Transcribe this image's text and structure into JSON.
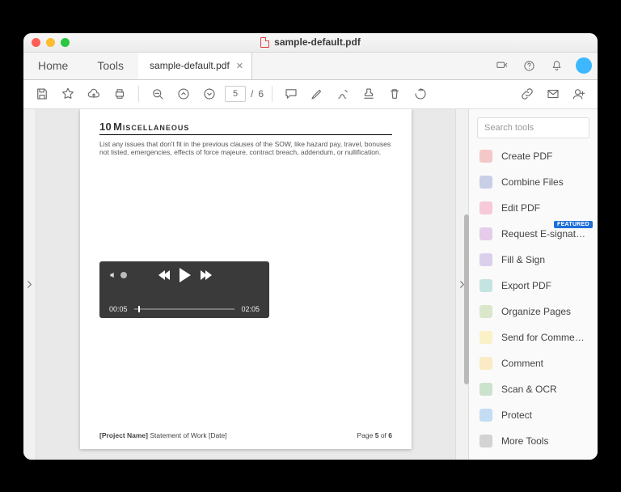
{
  "window": {
    "title": "sample-default.pdf"
  },
  "tabs": {
    "home": "Home",
    "tools": "Tools",
    "doc": "sample-default.pdf"
  },
  "toolbar": {
    "page_current": "5",
    "page_sep": "/",
    "page_total": "6"
  },
  "document": {
    "section_number": "10",
    "section_title": "Miscellaneous",
    "body": "List any issues that don't fit in the previous clauses of the SOW, like hazard pay, travel, bonuses not listed, emergencies, effects of force majeure, contract breach, addendum, or nullification.",
    "player": {
      "elapsed": "00:05",
      "total": "02:05"
    },
    "footer_left_bold": "[Project Name]",
    "footer_left_rest": " Statement of Work [Date]",
    "footer_right_prefix": "Page ",
    "footer_right_cur": "5",
    "footer_right_of": " of ",
    "footer_right_tot": "6"
  },
  "sidepanel": {
    "search_placeholder": "Search tools",
    "badge": "FEATURED",
    "tools": [
      {
        "label": "Create PDF",
        "color": "#e53935"
      },
      {
        "label": "Combine Files",
        "color": "#3f51b5"
      },
      {
        "label": "Edit PDF",
        "color": "#ec407a"
      },
      {
        "label": "Request E-signat…",
        "color": "#ab47bc",
        "featured": true
      },
      {
        "label": "Fill & Sign",
        "color": "#7e57c2"
      },
      {
        "label": "Export PDF",
        "color": "#26a69a"
      },
      {
        "label": "Organize Pages",
        "color": "#7cb342"
      },
      {
        "label": "Send for Comme…",
        "color": "#fdd835"
      },
      {
        "label": "Comment",
        "color": "#fbc02d"
      },
      {
        "label": "Scan & OCR",
        "color": "#43a047"
      },
      {
        "label": "Protect",
        "color": "#1e88e5"
      },
      {
        "label": "More Tools",
        "color": "#616161"
      }
    ]
  }
}
